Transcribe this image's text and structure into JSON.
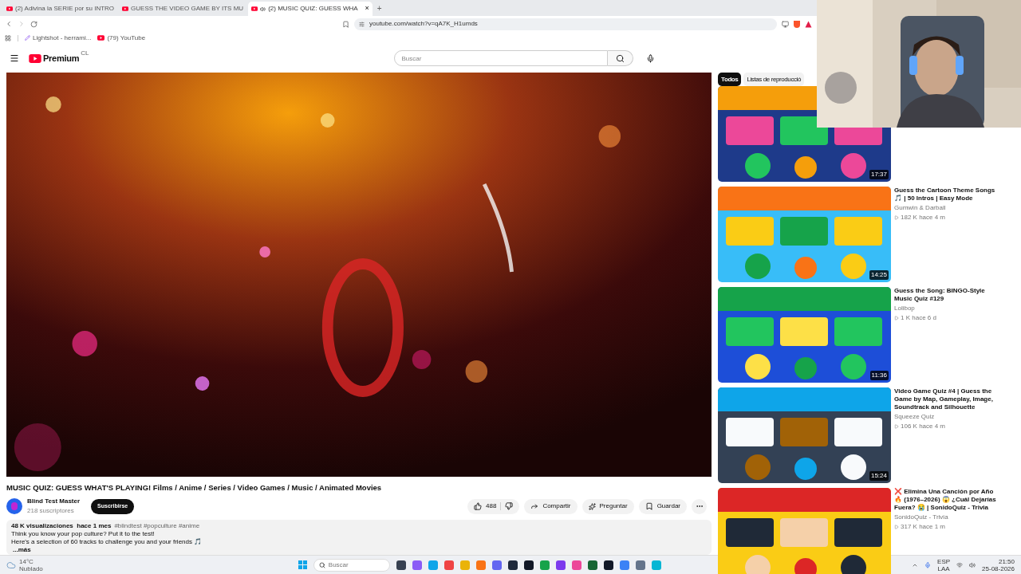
{
  "browser": {
    "tabs": [
      {
        "title": "(2) Adivina la SERIE por su INTRO",
        "selected": false,
        "audio": false
      },
      {
        "title": "GUESS THE VIDEO GAME BY ITS MU",
        "selected": false,
        "audio": false
      },
      {
        "title": "(2) MUSIC QUIZ: GUESS WHA",
        "selected": true,
        "audio": true
      }
    ],
    "new_tab": "+",
    "close": "×",
    "address": "youtube.com/watch?v=qA7K_H1umds",
    "bookmarks": [
      "Lightshot - herrami...",
      "(79) YouTube"
    ]
  },
  "header": {
    "logo": "Premium",
    "region": "CL",
    "search": {
      "placeholder": "Buscar"
    }
  },
  "video": {
    "title": "MUSIC QUIZ: GUESS WHAT'S PLAYING! Films / Anime / Series / Video Games / Music / Animated Movies",
    "channel": "Blind Test Master",
    "subscribers": "218 suscriptores",
    "subscribe": "Suscribirse",
    "likes": "488",
    "actions": [
      "Compartir",
      "Preguntar",
      "Guardar"
    ],
    "stats": "48 K visualizaciones  hace 1 mes",
    "tags": "#blindtest #popculture #anime",
    "description": [
      "Think you know your pop culture? Put it to the test!",
      "Here's a selection of 60 tracks to challenge you and your friends 🎵"
    ],
    "more": "...más"
  },
  "chips": [
    {
      "label": "Todos",
      "selected": true
    },
    {
      "label": "Listas de reproducció",
      "selected": false
    }
  ],
  "recommendations": [
    {
      "duration": "17:37"
    },
    {
      "title": "Guess the Cartoon Theme Songs 🎵 | 50 Intros | Easy Mode",
      "channel": "Gumwin & Darball",
      "meta": "182 K  hace 4 m",
      "duration": "14:25"
    },
    {
      "title": "Guess the Song: BINGO-Style Music Quiz #129",
      "channel": "Lolibop",
      "meta": "1 K  hace 6 d",
      "duration": "11:36"
    },
    {
      "title": "Video Game Quiz #4 | Guess the Game by Map, Gameplay, Image, Soundtrack and Silhouette",
      "channel": "Squeeze Quiz",
      "meta": "106 K  hace 4 m",
      "duration": "15:24"
    },
    {
      "title": "❌ Elimina Una Canción por Año 🔥 (1976–2026) 😱 ¿Cuál Dejarías Fuera? 😭 | SonidoQuiz - Trivia",
      "channel": "SonidoQuiz - Trivia",
      "meta": "317 K  hace 1 m"
    }
  ],
  "taskbar": {
    "temperature": "14°C",
    "weather": "Nublado",
    "search": {
      "placeholder": "Buscar"
    },
    "language": "ESP",
    "layout": "LAA",
    "time": "21:50",
    "date": "25-08-2026"
  }
}
